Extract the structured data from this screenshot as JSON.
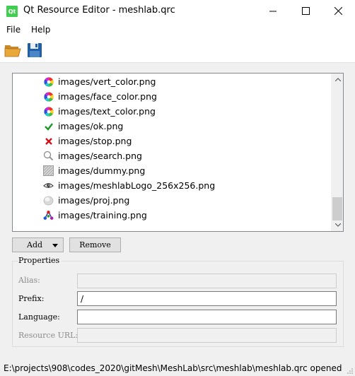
{
  "window": {
    "app_icon_text": "Qt",
    "title": "Qt Resource Editor - meshlab.qrc"
  },
  "menu": {
    "file": "File",
    "help": "Help"
  },
  "toolbar": {
    "open_icon": "folder-open-icon",
    "save_icon": "floppy-disk-icon"
  },
  "resources": [
    {
      "path": "images/vert_color.png",
      "icon": "color-wheel-icon"
    },
    {
      "path": "images/face_color.png",
      "icon": "color-wheel-icon"
    },
    {
      "path": "images/text_color.png",
      "icon": "color-wheel-icon"
    },
    {
      "path": "images/ok.png",
      "icon": "checkmark-icon"
    },
    {
      "path": "images/stop.png",
      "icon": "red-x-icon"
    },
    {
      "path": "images/search.png",
      "icon": "magnifier-icon"
    },
    {
      "path": "images/dummy.png",
      "icon": "checker-icon"
    },
    {
      "path": "images/meshlabLogo_256x256.png",
      "icon": "eye-logo-icon"
    },
    {
      "path": "images/proj.png",
      "icon": "sphere-icon"
    },
    {
      "path": "images/training.png",
      "icon": "molecule-icon"
    }
  ],
  "buttons": {
    "add": "Add",
    "remove": "Remove"
  },
  "properties": {
    "title": "Properties",
    "alias_label": "Alias:",
    "alias_value": "",
    "prefix_label": "Prefix:",
    "prefix_value": "/",
    "language_label": "Language:",
    "language_value": "",
    "url_label": "Resource URL:",
    "url_value": ""
  },
  "status": {
    "text": "E:\\projects\\908\\codes_2020\\gitMesh\\MeshLab\\src\\meshlab\\meshlab.qrc opened"
  },
  "colors": {
    "qt_green": "#41cd52",
    "ok_green": "#1a9a2a",
    "stop_red": "#d0101c"
  }
}
